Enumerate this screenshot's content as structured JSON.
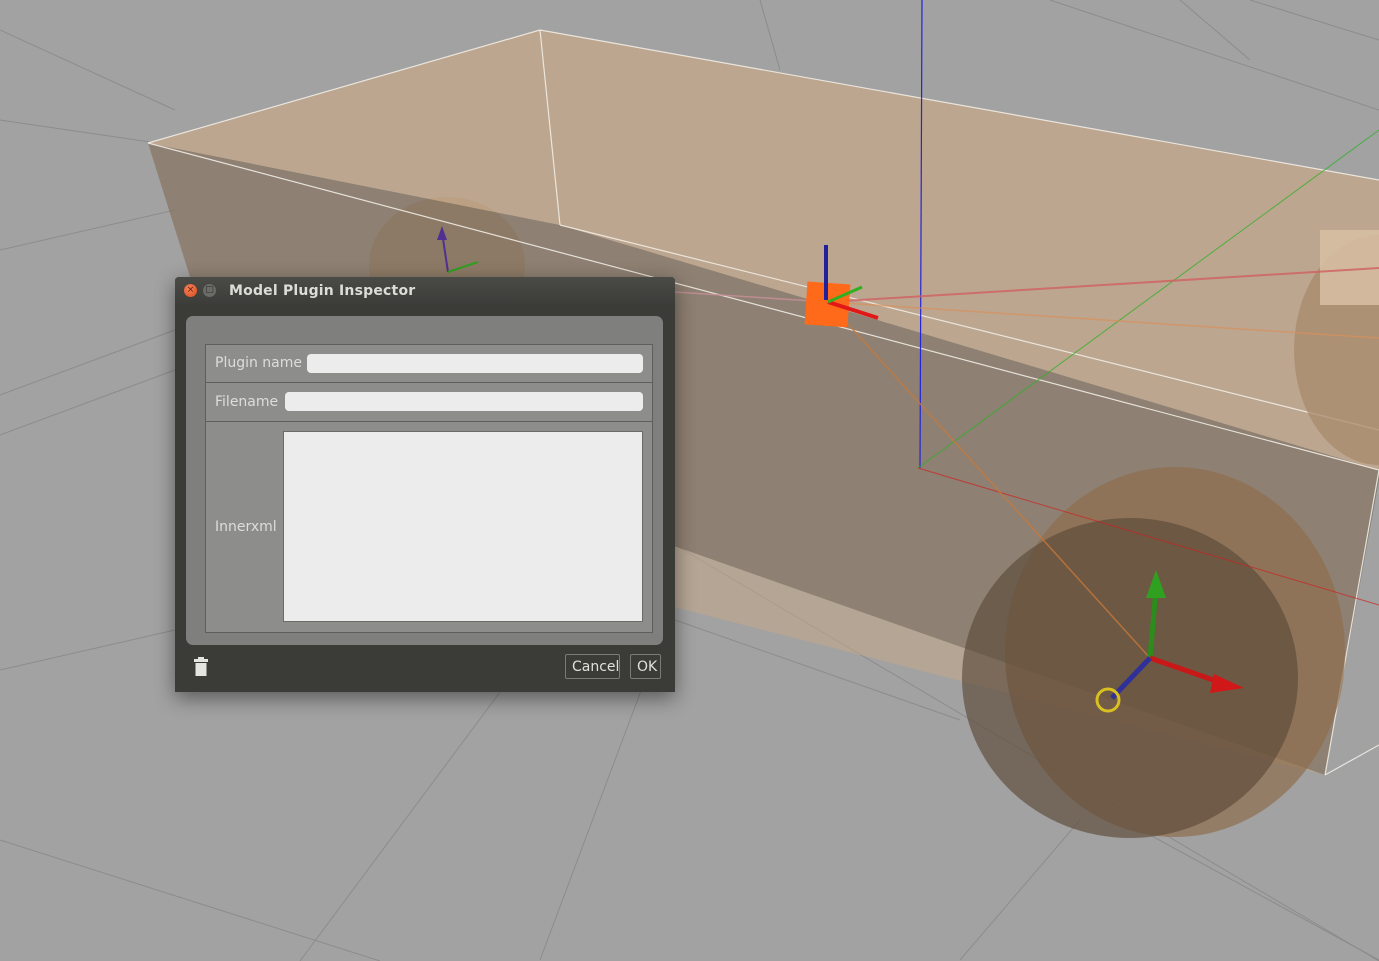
{
  "dialog": {
    "title": "Model Plugin Inspector",
    "close_glyph": "×",
    "minimize_glyph": "□"
  },
  "form": {
    "plugin_name_label": "Plugin name",
    "plugin_name_value": "",
    "filename_label": "Filename",
    "filename_value": "",
    "innerxml_label": "Innerxml",
    "innerxml_value": ""
  },
  "buttons": {
    "cancel_label": "Cancel",
    "ok_label": "OK"
  },
  "icons": {
    "close": "close-icon",
    "minimize": "minimize-icon",
    "delete": "trash-icon"
  },
  "colors": {
    "ground": "#a2a2a2",
    "box_fill": "#c8a888",
    "wheel_fill": "#a07a55",
    "axis_x": "#e02020",
    "axis_y": "#30a020",
    "axis_z": "#2020c8",
    "link_marker": "#ff6a1a",
    "joint_ring": "#d8c020"
  }
}
